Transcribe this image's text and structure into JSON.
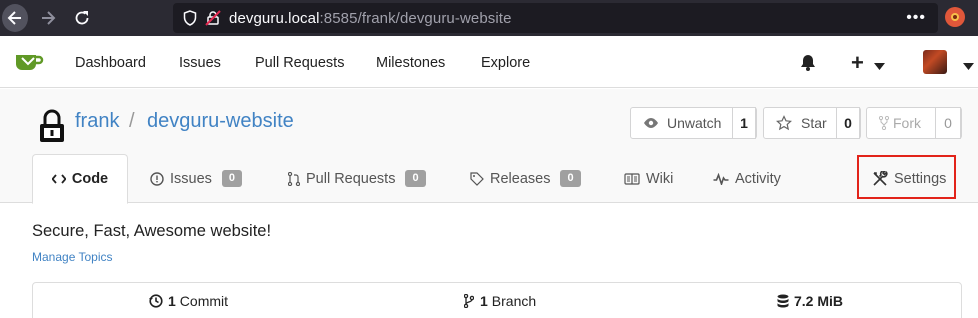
{
  "browser": {
    "url_host": "devguru.local",
    "url_rest": ":8585/frank/devguru-website",
    "menu_dots": "•••"
  },
  "header": {
    "nav": [
      "Dashboard",
      "Issues",
      "Pull Requests",
      "Milestones",
      "Explore"
    ],
    "plus": "+"
  },
  "repo": {
    "owner": "frank",
    "separator": "/",
    "name": "devguru-website",
    "unwatch_label": "Unwatch",
    "watch_count": "1",
    "star_label": "Star",
    "star_count": "0",
    "fork_label": "Fork",
    "fork_count": "0"
  },
  "tabs": {
    "code": "Code",
    "issues": "Issues",
    "issues_count": "0",
    "pulls": "Pull Requests",
    "pulls_count": "0",
    "releases": "Releases",
    "releases_count": "0",
    "wiki": "Wiki",
    "activity": "Activity",
    "settings": "Settings"
  },
  "main": {
    "description": "Secure, Fast, Awesome website!",
    "manage_topics": "Manage Topics"
  },
  "stats": {
    "commits_num": "1",
    "commits_label": "Commit",
    "branches_num": "1",
    "branches_label": "Branch",
    "size": "7.2 MiB"
  },
  "colors": {
    "link": "#4183c4",
    "highlight": "#e2231a",
    "browser_bg": "#2b2a33",
    "logo_green": "#609926"
  }
}
